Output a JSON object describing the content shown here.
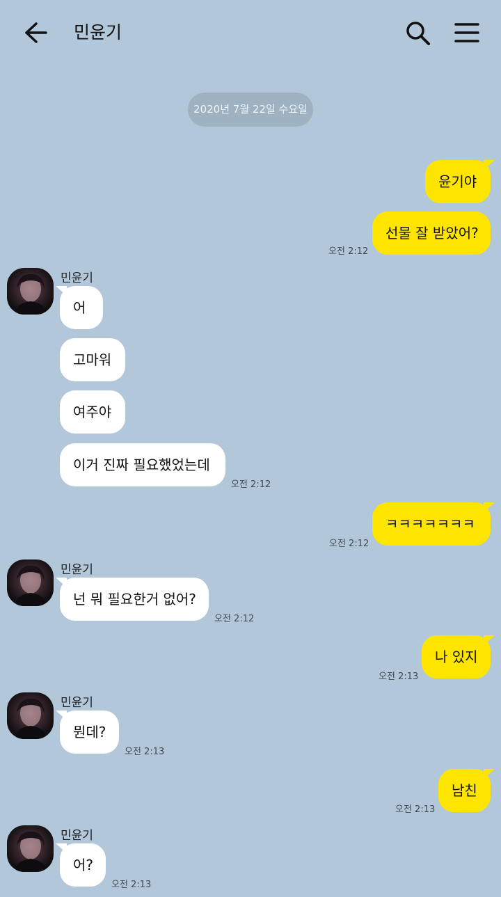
{
  "header": {
    "title": "민윤기"
  },
  "date_divider": "2020년 7월 22일 수요일",
  "contact_name": "민윤기",
  "messages": [
    {
      "text": "윤기야",
      "time": ""
    },
    {
      "text": "선물 잘 받았어?",
      "time": "오전 2:12"
    },
    {
      "text": "어",
      "time": ""
    },
    {
      "text": "고마워",
      "time": ""
    },
    {
      "text": "여주야",
      "time": ""
    },
    {
      "text": "이거 진짜 필요했었는데",
      "time": "오전 2:12"
    },
    {
      "text": "ㅋㅋㅋㅋㅋㅋㅋ",
      "time": "오전 2:12"
    },
    {
      "text": "넌 뭐 필요한거 없어?",
      "time": "오전 2:12"
    },
    {
      "text": "나 있지",
      "time": "오전 2:13"
    },
    {
      "text": "뭔데?",
      "time": "오전 2:13"
    },
    {
      "text": "남친",
      "time": "오전 2:13"
    },
    {
      "text": "어?",
      "time": "오전 2:13"
    }
  ],
  "icons": {
    "back": "arrow-left-icon",
    "search": "search-icon",
    "menu": "menu-icon"
  },
  "colors": {
    "background": "#b2c7da",
    "my_bubble": "#fee500",
    "their_bubble": "#ffffff"
  }
}
